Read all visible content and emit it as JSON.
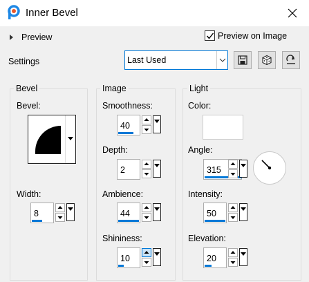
{
  "window": {
    "title": "Inner Bevel"
  },
  "preview": {
    "toggle_label": "Preview",
    "checkbox_label": "Preview on Image",
    "checked": true
  },
  "settings": {
    "label": "Settings",
    "selected": "Last Used"
  },
  "bevel_group": {
    "title": "Bevel",
    "bevel_label": "Bevel:",
    "width_label": "Width:",
    "width_value": "8"
  },
  "image_group": {
    "title": "Image",
    "smoothness_label": "Smoothness:",
    "smoothness_value": "40",
    "depth_label": "Depth:",
    "depth_value": "2",
    "ambience_label": "Ambience:",
    "ambience_value": "44",
    "shininess_label": "Shininess:",
    "shininess_value": "10"
  },
  "light_group": {
    "title": "Light",
    "color_label": "Color:",
    "color_value": "#ffffff",
    "angle_label": "Angle:",
    "angle_value": "315",
    "intensity_label": "Intensity:",
    "intensity_value": "50",
    "elevation_label": "Elevation:",
    "elevation_value": "20"
  },
  "colors": {
    "accent": "#0078d7",
    "icon_blue": "#1e88e5",
    "icon_orange": "#e8582b"
  },
  "icons": [
    "app-logo-icon",
    "close-icon",
    "expand-arrow-icon",
    "checkmark-icon",
    "save-preset-icon",
    "randomize-dice-icon",
    "reset-arrow-icon"
  ]
}
